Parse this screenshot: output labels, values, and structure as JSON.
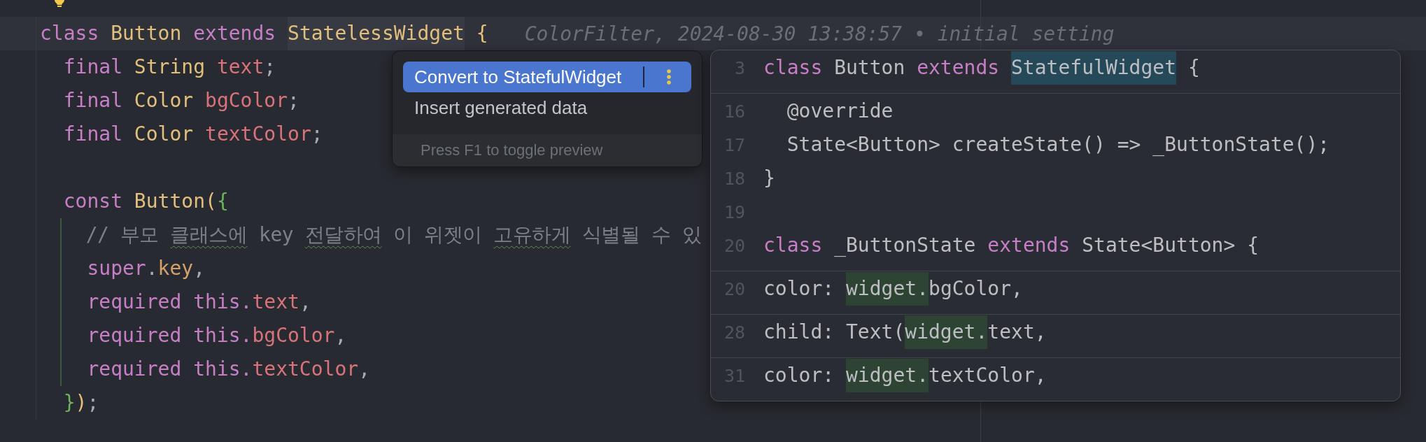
{
  "editor": {
    "lines": [
      {
        "current": true,
        "guide": false,
        "tokens": [
          {
            "text": "class",
            "kind": "keyword"
          },
          {
            "text": " Button",
            "kind": "type"
          },
          {
            "text": " extends ",
            "kind": "keyword"
          },
          {
            "text": "StatelessWidget",
            "kind": "type-usage"
          },
          {
            "text": " {",
            "kind": "bracket-outer"
          }
        ],
        "blame": "ColorFilter, 2024-08-30 13:38:57 • initial setting"
      },
      {
        "current": false,
        "guide": false,
        "tokens": [
          {
            "text": "  final",
            "kind": "keyword"
          },
          {
            "text": " String",
            "kind": "type"
          },
          {
            "text": " text",
            "kind": "field"
          },
          {
            "text": ";",
            "kind": "punct"
          }
        ]
      },
      {
        "current": false,
        "guide": false,
        "tokens": [
          {
            "text": "  final",
            "kind": "keyword"
          },
          {
            "text": " Color",
            "kind": "type"
          },
          {
            "text": " bgColor",
            "kind": "field"
          },
          {
            "text": ";",
            "kind": "punct"
          }
        ]
      },
      {
        "current": false,
        "guide": false,
        "tokens": [
          {
            "text": "  final",
            "kind": "keyword"
          },
          {
            "text": " Color",
            "kind": "type"
          },
          {
            "text": " textColor",
            "kind": "field"
          },
          {
            "text": ";",
            "kind": "punct"
          }
        ]
      },
      {
        "current": false,
        "guide": false
      },
      {
        "current": false,
        "guide": false,
        "tokens": [
          {
            "text": "  const",
            "kind": "keyword"
          },
          {
            "text": " Button",
            "kind": "type"
          },
          {
            "text": "(",
            "kind": "bracket-outer"
          },
          {
            "text": "{",
            "kind": "bracket-inner"
          }
        ]
      },
      {
        "current": false,
        "guide": true,
        "tokens": [
          {
            "text": "    // 부모 ",
            "kind": "comment"
          },
          {
            "text": "클래스에",
            "kind": "comment-typo"
          },
          {
            "text": " key ",
            "kind": "comment"
          },
          {
            "text": "전달하여",
            "kind": "comment-typo"
          },
          {
            "text": " 이 위젯이 ",
            "kind": "comment"
          },
          {
            "text": "고유하게",
            "kind": "comment-typo"
          },
          {
            "text": " 식별될 수 있",
            "kind": "comment"
          }
        ]
      },
      {
        "current": false,
        "guide": true,
        "tokens": [
          {
            "text": "    super",
            "kind": "keyword"
          },
          {
            "text": ".",
            "kind": "punct"
          },
          {
            "text": "key",
            "kind": "property"
          },
          {
            "text": ",",
            "kind": "punct"
          }
        ]
      },
      {
        "current": false,
        "guide": true,
        "tokens": [
          {
            "text": "    required this.",
            "kind": "keyword"
          },
          {
            "text": "text",
            "kind": "field"
          },
          {
            "text": ",",
            "kind": "punct"
          }
        ]
      },
      {
        "current": false,
        "guide": true,
        "tokens": [
          {
            "text": "    required this.",
            "kind": "keyword"
          },
          {
            "text": "bgColor",
            "kind": "field"
          },
          {
            "text": ",",
            "kind": "punct"
          }
        ]
      },
      {
        "current": false,
        "guide": true,
        "tokens": [
          {
            "text": "    required this.",
            "kind": "keyword"
          },
          {
            "text": "textColor",
            "kind": "field"
          },
          {
            "text": ",",
            "kind": "punct"
          }
        ]
      },
      {
        "current": false,
        "guide": false,
        "tokens": [
          {
            "text": "  }",
            "kind": "bracket-inner"
          },
          {
            "text": ")",
            "kind": "bracket-outer"
          },
          {
            "text": ";",
            "kind": "punct"
          }
        ]
      }
    ]
  },
  "intention_popup": {
    "items": [
      {
        "label": "Convert to StatefulWidget",
        "selected": true
      },
      {
        "label": "Insert generated data",
        "selected": false
      }
    ],
    "footer": "Press F1 to toggle preview"
  },
  "preview": {
    "sections": [
      {
        "lines": [
          {
            "number": "3",
            "tokens": [
              {
                "text": "class",
                "kind": "keyword"
              },
              {
                "text": " Button ",
                "kind": "plain"
              },
              {
                "text": "extends ",
                "kind": "keyword"
              },
              {
                "text": "StatefulWidget",
                "kind": "plain-changed"
              },
              {
                "text": " {",
                "kind": "plain"
              }
            ]
          }
        ]
      },
      {
        "lines": [
          {
            "number": "16",
            "tokens": [
              {
                "text": "  @override",
                "kind": "plain"
              }
            ]
          },
          {
            "number": "17",
            "tokens": [
              {
                "text": "  State<Button> createState() => _ButtonState();",
                "kind": "plain"
              }
            ]
          },
          {
            "number": "18",
            "tokens": [
              {
                "text": "}",
                "kind": "plain"
              }
            ]
          },
          {
            "number": "19"
          },
          {
            "number": "20",
            "tokens": [
              {
                "text": "class",
                "kind": "keyword"
              },
              {
                "text": " _ButtonState ",
                "kind": "plain"
              },
              {
                "text": "extends",
                "kind": "keyword"
              },
              {
                "text": " State<Button> {",
                "kind": "plain"
              }
            ]
          }
        ]
      },
      {
        "lines": [
          {
            "number": "20",
            "tokens": [
              {
                "text": "color: ",
                "kind": "plain"
              },
              {
                "text": "widget.",
                "kind": "plain-added"
              },
              {
                "text": "bgColor,",
                "kind": "plain"
              }
            ]
          }
        ]
      },
      {
        "lines": [
          {
            "number": "28",
            "tokens": [
              {
                "text": "child: Text(",
                "kind": "plain"
              },
              {
                "text": "widget.",
                "kind": "plain-added"
              },
              {
                "text": "text,",
                "kind": "plain"
              }
            ]
          }
        ]
      },
      {
        "lines": [
          {
            "number": "31",
            "tokens": [
              {
                "text": "color: ",
                "kind": "plain"
              },
              {
                "text": "widget.",
                "kind": "plain-added"
              },
              {
                "text": "textColor,",
                "kind": "plain"
              }
            ]
          }
        ]
      }
    ]
  }
}
